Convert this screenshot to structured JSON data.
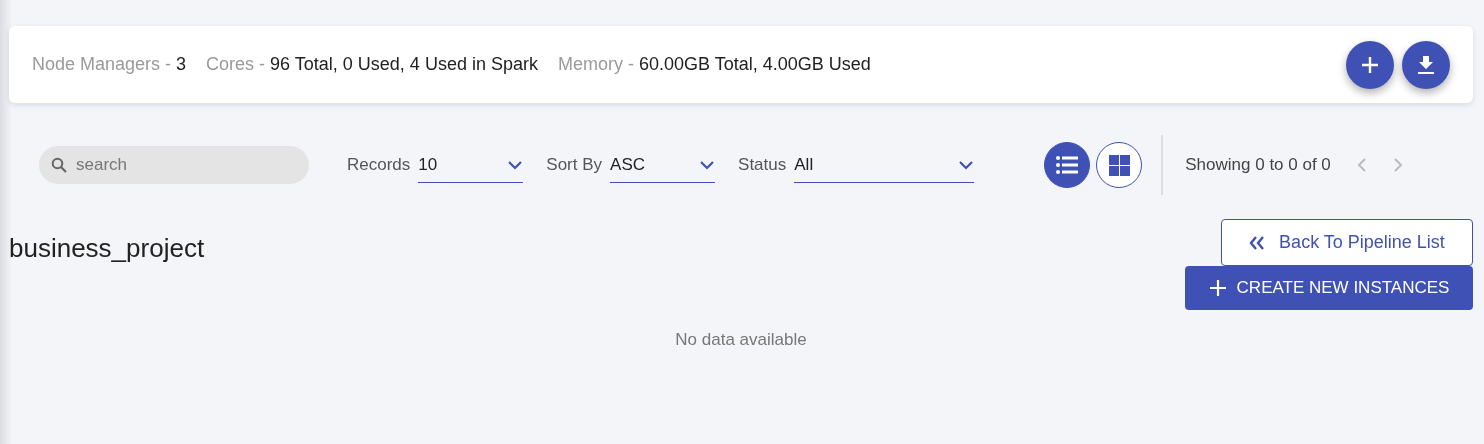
{
  "summary": {
    "stats": [
      {
        "label": "Node Managers -",
        "value": "3"
      },
      {
        "label": "Cores -",
        "value": "96 Total, 0 Used, 4 Used in Spark"
      },
      {
        "label": "Memory -",
        "value": "60.00GB Total, 4.00GB Used"
      }
    ],
    "actions": [
      {
        "kind": "add"
      },
      {
        "kind": "download"
      }
    ]
  },
  "toolbar": {
    "search": {
      "placeholder": "search"
    },
    "filters": [
      {
        "label": "Records",
        "value": "10"
      },
      {
        "label": "Sort By",
        "value": "ASC"
      },
      {
        "label": "Status",
        "value": "All"
      }
    ],
    "views": [
      {
        "kind": "list",
        "selected": true
      },
      {
        "kind": "grid",
        "selected": false
      }
    ],
    "pagination": {
      "text": "Showing 0 to 0 of 0",
      "prev_disabled": true,
      "next_disabled": true
    }
  },
  "project": {
    "title": "business_project",
    "back_button": "Back To Pipeline List",
    "create_button": "CREATE NEW INSTANCES",
    "empty_text": "No data available"
  }
}
